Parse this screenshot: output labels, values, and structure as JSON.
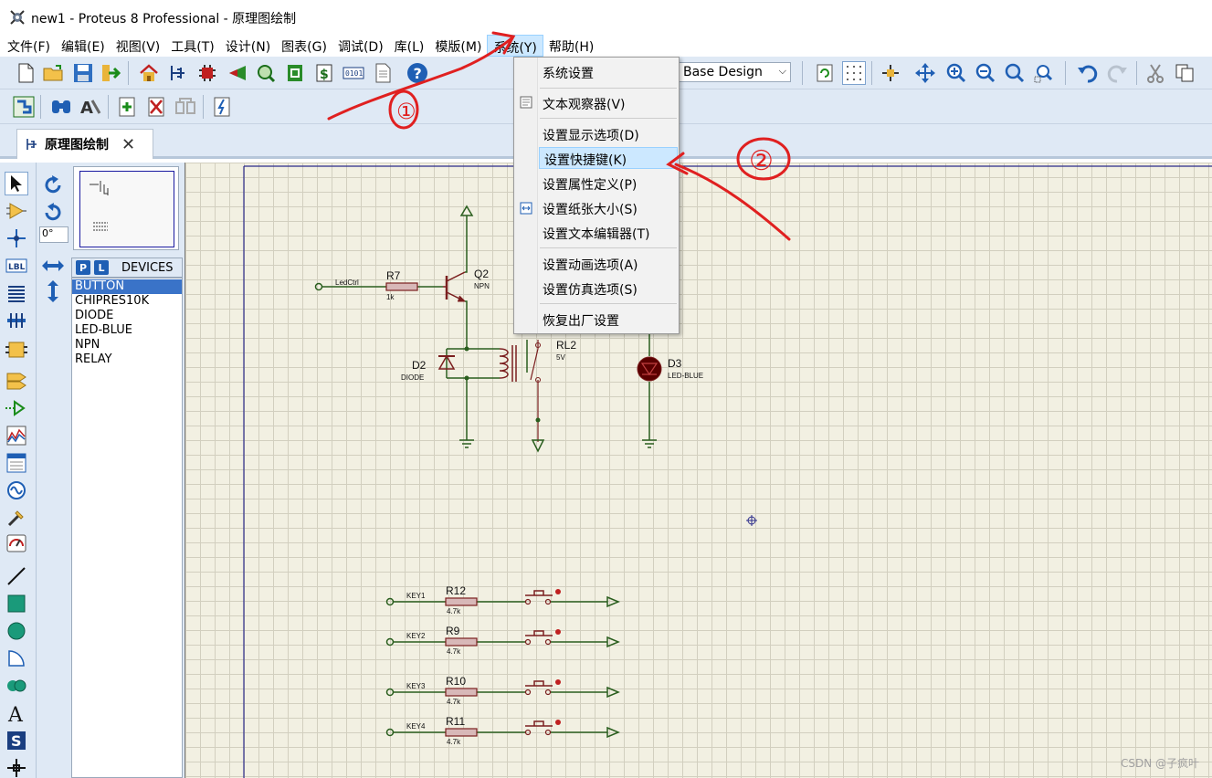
{
  "window": {
    "title": "new1 - Proteus 8 Professional - 原理图绘制"
  },
  "menu": [
    "文件(F)",
    "编辑(E)",
    "视图(V)",
    "工具(T)",
    "设计(N)",
    "图表(G)",
    "调试(D)",
    "库(L)",
    "模版(M)",
    "系统(Y)",
    "帮助(H)"
  ],
  "active_menu": "系统(Y)",
  "system_menu_items": [
    "系统设置",
    "文本观察器(V)",
    "设置显示选项(D)",
    "设置快捷键(K)",
    "设置属性定义(P)",
    "设置纸张大小(S)",
    "设置文本编辑器(T)",
    "设置动画选项(A)",
    "设置仿真选项(S)",
    "恢复出厂设置"
  ],
  "highlighted_item": "设置快捷键(K)",
  "toolbar": {
    "layer_select": "Base Design"
  },
  "tab": {
    "label": "原理图绘制"
  },
  "object_panel": {
    "angle": "0°",
    "p_btn": "P",
    "l_btn": "L",
    "header": "DEVICES",
    "devices": [
      "BUTTON",
      "CHIPRES10K",
      "DIODE",
      "LED-BLUE",
      "NPN",
      "RELAY"
    ],
    "selected": "BUTTON"
  },
  "schematic": {
    "r7": "R7",
    "r7_val": "1k",
    "ledctrl": "LedCtrl",
    "q2": "Q2",
    "q2_type": "NPN",
    "d2": "D2",
    "d2_type": "DIODE",
    "rl2": "RL2",
    "rl2_val": "5V",
    "d3": "D3",
    "d3_type": "LED-BLUE",
    "keys": [
      {
        "net": "KEY1",
        "ref": "R12",
        "val": "4.7k"
      },
      {
        "net": "KEY2",
        "ref": "R9",
        "val": "4.7k"
      },
      {
        "net": "KEY3",
        "ref": "R10",
        "val": "4.7k"
      },
      {
        "net": "KEY4",
        "ref": "R11",
        "val": "4.7k"
      }
    ]
  },
  "annotations": {
    "step1": "①",
    "step2": "②"
  },
  "watermark": "CSDN @子疯叶",
  "colors": {
    "wire": "#2a5e1e",
    "part": "#7a1e1e",
    "annotation": "#e02020",
    "accent": "#cce8ff"
  }
}
